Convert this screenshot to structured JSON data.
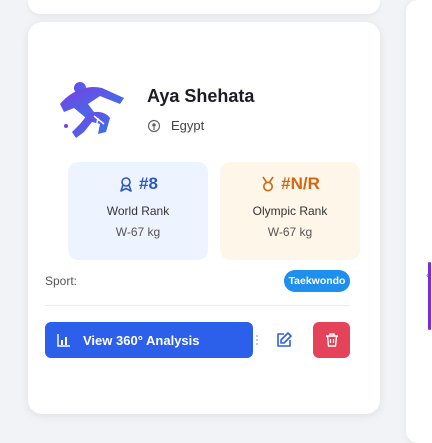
{
  "athlete": {
    "name": "Aya Shehata",
    "country": "Egypt"
  },
  "rankings": {
    "world": {
      "value": "#8",
      "label": "World Rank",
      "weight_class": "W-67 kg"
    },
    "olympic": {
      "value": "#N/R",
      "label": "Olympic Rank",
      "weight_class": "W-67 kg"
    }
  },
  "sport": {
    "label": "Sport:",
    "value": "Taekwondo"
  },
  "actions": {
    "analysis_label": "View 360° Analysis"
  },
  "colors": {
    "primary_button": "#2c5fea",
    "delete_button": "#e5435a",
    "sport_badge": "#1e8eef",
    "world_rank": "#2a57c8",
    "olympic_rank": "#d06812"
  },
  "icons": {
    "avatar": "taekwondo-fighter-icon",
    "country": "location-pin-icon",
    "world_rank": "ribbon-icon",
    "olympic_rank": "medal-icon",
    "analysis": "bar-chart-icon",
    "edit": "edit-icon",
    "delete": "trash-icon"
  }
}
